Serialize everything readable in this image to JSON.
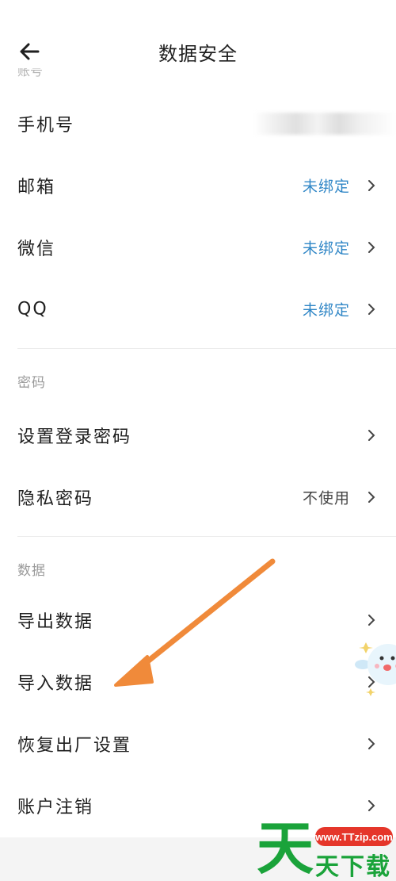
{
  "header": {
    "title": "数据安全",
    "cut_section_label": "账号"
  },
  "account": {
    "items": [
      {
        "label": "手机号",
        "value": ""
      },
      {
        "label": "邮箱",
        "value": "未绑定"
      },
      {
        "label": "微信",
        "value": "未绑定"
      },
      {
        "label": "QQ",
        "value": "未绑定"
      }
    ]
  },
  "password": {
    "section_title": "密码",
    "items": [
      {
        "label": "设置登录密码",
        "value": ""
      },
      {
        "label": "隐私密码",
        "value": "不使用"
      }
    ]
  },
  "data": {
    "section_title": "数据",
    "items": [
      {
        "label": "导出数据"
      },
      {
        "label": "导入数据"
      },
      {
        "label": "恢复出厂设置"
      },
      {
        "label": "账户注销"
      }
    ]
  },
  "watermark": {
    "url": "www.TTzip.com",
    "big_char": "天",
    "text": "天下载"
  },
  "colors": {
    "link": "#2f86c6",
    "annotation_arrow": "#f08a3a"
  }
}
